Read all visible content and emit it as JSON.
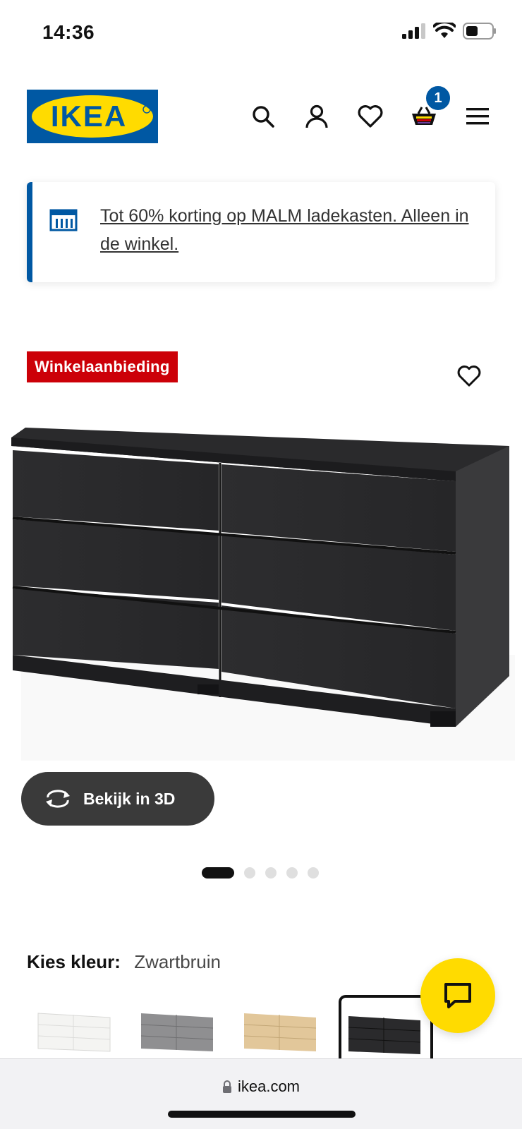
{
  "status_bar": {
    "time": "14:36"
  },
  "header": {
    "logo_text": "IKEA",
    "cart_count": "1"
  },
  "promo": {
    "text": "Tot 60% korting op MALM ladekasten. Alleen in de winkel."
  },
  "product": {
    "badge": "Winkelaanbieding",
    "view_3d_label": "Bekijk in 3D",
    "image_count": 5,
    "active_image_index": 0
  },
  "color_picker": {
    "label": "Kies kleur:",
    "value": "Zwartbruin",
    "options": [
      "white",
      "gray",
      "oak",
      "black-brown"
    ],
    "selected": "black-brown"
  },
  "browser": {
    "url": "ikea.com"
  },
  "colors": {
    "brand_blue": "#0058a3",
    "brand_yellow": "#ffdb00",
    "sale_red": "#cc0008"
  }
}
